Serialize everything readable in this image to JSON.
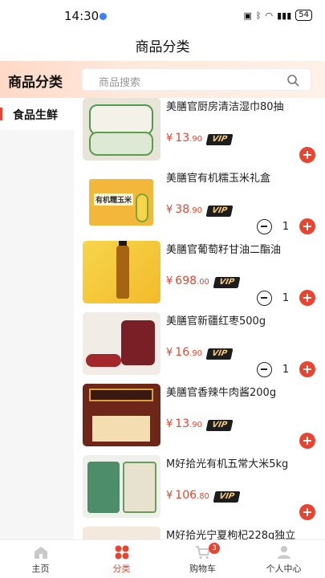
{
  "status_bar": {
    "time": "14:30",
    "battery": "54"
  },
  "header": {
    "title": "商品分类"
  },
  "category_bar": {
    "label": "商品分类",
    "search_placeholder": "商品搜索"
  },
  "sidebar": {
    "items": [
      {
        "label": "食品生鲜",
        "selected": true
      }
    ]
  },
  "products": [
    {
      "name": "美膳官厨房清洁湿巾80抽",
      "currency": "¥",
      "price_int": "13",
      "price_dec": ".90",
      "vip": "VIP",
      "quantity": null
    },
    {
      "name": "美膳官有机糯玉米礼盒",
      "currency": "¥",
      "price_int": "38",
      "price_dec": ".90",
      "vip": "VIP",
      "quantity": "1",
      "thumb_text": "有机糯玉米"
    },
    {
      "name": "美膳官葡萄籽甘油二酯油",
      "currency": "¥",
      "price_int": "698",
      "price_dec": ".00",
      "vip": "VIP",
      "quantity": "1"
    },
    {
      "name": "美膳官新疆红枣500g",
      "currency": "¥",
      "price_int": "16",
      "price_dec": ".90",
      "vip": "VIP",
      "quantity": "1"
    },
    {
      "name": "美膳官香辣牛肉酱200g",
      "currency": "¥",
      "price_int": "13",
      "price_dec": ".90",
      "vip": "VIP",
      "quantity": null
    },
    {
      "name": "M好拾光有机五常大米5kg",
      "currency": "¥",
      "price_int": "106",
      "price_dec": ".80",
      "vip": "VIP",
      "quantity": null
    },
    {
      "name": "M好拾光宁夏枸杞228g独立",
      "currency": "¥",
      "price_int": "",
      "price_dec": "",
      "vip": "",
      "quantity": null
    }
  ],
  "tabbar": {
    "items": [
      {
        "label": "主页",
        "icon": "home-icon",
        "active": false
      },
      {
        "label": "分类",
        "icon": "category-icon",
        "active": true
      },
      {
        "label": "购物车",
        "icon": "cart-icon",
        "active": false,
        "badge": "3"
      },
      {
        "label": "个人中心",
        "icon": "user-icon",
        "active": false
      }
    ]
  },
  "colors": {
    "accent": "#e8442f",
    "vip_bg": "#1d1d1d",
    "vip_text": "#f2c879"
  }
}
